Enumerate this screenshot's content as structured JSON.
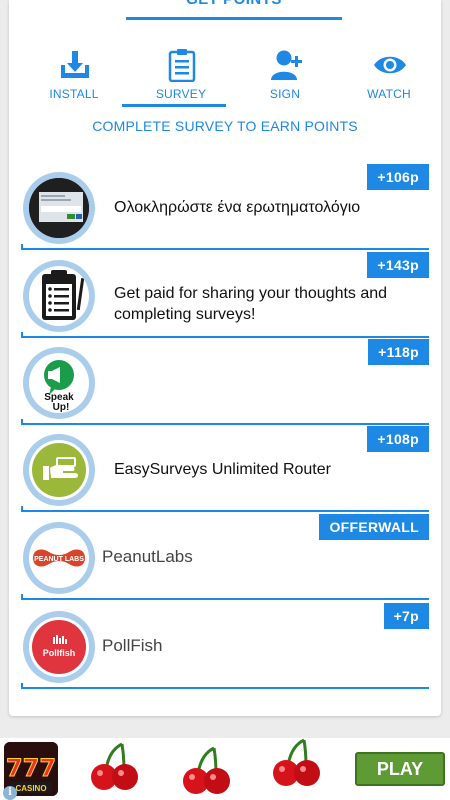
{
  "header": {
    "title": "GET POINTS"
  },
  "tabs": [
    {
      "label": "INSTALL",
      "icon": "download-icon"
    },
    {
      "label": "SURVEY",
      "icon": "clipboard-icon",
      "active": true
    },
    {
      "label": "SIGN",
      "icon": "add-user-icon"
    },
    {
      "label": "WATCH",
      "icon": "eye-icon"
    }
  ],
  "subtitle": "COMPLETE SURVEY TO EARN POINTS",
  "offers": [
    {
      "badge": "+106p",
      "title": "Ολοκληρώστε ένα ερωτηματολόγιο",
      "icon": "survey-screenshot-icon"
    },
    {
      "badge": "+143p",
      "title": "Get paid for sharing your thoughts and completing surveys!",
      "icon": "clipboard-checklist-icon"
    },
    {
      "badge": "+118p",
      "title": "",
      "icon": "speak-up-logo",
      "logo_text": "Speak Up!"
    },
    {
      "badge": "+108p",
      "title": "EasySurveys Unlimited Router",
      "icon": "hand-money-icon"
    },
    {
      "badge": "OFFERWALL",
      "title": "PeanutLabs",
      "icon": "peanut-labs-logo",
      "logo_text": "PEANUT LABS"
    },
    {
      "badge": "+7p",
      "title": "PollFish",
      "icon": "pollfish-logo",
      "logo_text": "Pollfish"
    }
  ],
  "ad": {
    "play_label": "PLAY",
    "slot_icon": "slot-machine-777-icon",
    "slot_text": "CASINO"
  },
  "colors": {
    "accent": "#1e88e5",
    "ring": "#a9cdeb",
    "play": "#5f9b35"
  }
}
